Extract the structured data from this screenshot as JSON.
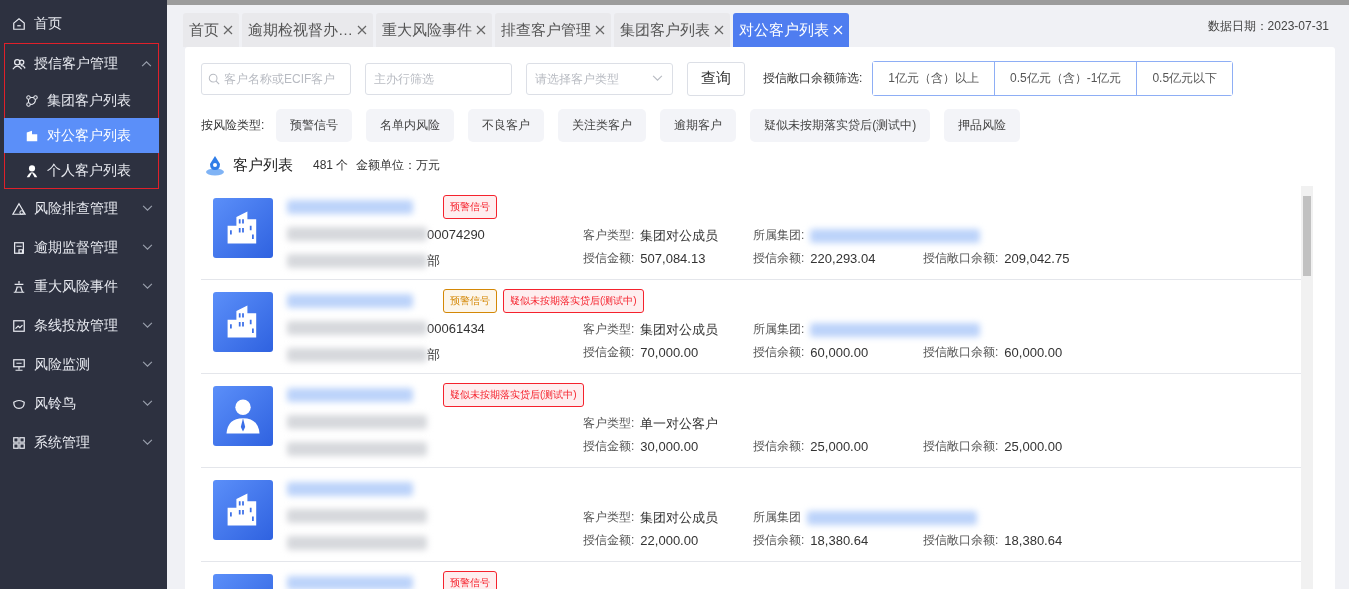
{
  "sidebar": {
    "items": [
      {
        "label": "首页",
        "expanded": false,
        "outlined": false
      },
      {
        "label": "授信客户管理",
        "expanded": true,
        "outlined": true,
        "children": [
          {
            "label": "集团客户列表",
            "selected": false
          },
          {
            "label": "对公客户列表",
            "selected": true
          },
          {
            "label": "个人客户列表",
            "selected": false
          }
        ]
      },
      {
        "label": "风险排查管理",
        "expanded": false,
        "outlined": false
      },
      {
        "label": "逾期监督管理",
        "expanded": false,
        "outlined": false
      },
      {
        "label": "重大风险事件",
        "expanded": false,
        "outlined": false
      },
      {
        "label": "条线投放管理",
        "expanded": false,
        "outlined": false
      },
      {
        "label": "风险监测",
        "expanded": false,
        "outlined": false
      },
      {
        "label": "风铃鸟",
        "expanded": false,
        "outlined": false
      },
      {
        "label": "系统管理",
        "expanded": false,
        "outlined": false
      }
    ]
  },
  "tabs": [
    {
      "label": "首页",
      "selected": false
    },
    {
      "label": "逾期检视督办…",
      "selected": false
    },
    {
      "label": "重大风险事件",
      "selected": false
    },
    {
      "label": "排查客户管理",
      "selected": false
    },
    {
      "label": "集团客户列表",
      "selected": false
    },
    {
      "label": "对公客户列表",
      "selected": true
    }
  ],
  "data_date": "数据日期：2023-07-31",
  "filters": {
    "search": {
      "placeholder": "客户名称或ECIF客户"
    },
    "branch": {
      "placeholder": "主办行筛选"
    },
    "customer_type": {
      "placeholder": "请选择客户类型"
    },
    "query_button": "查询",
    "exposure_label": "授信敞口余额筛选:",
    "exposure_options": [
      {
        "label": "1亿元（含）以上",
        "selected": false
      },
      {
        "label": "0.5亿元（含）-1亿元",
        "selected": false
      },
      {
        "label": "0.5亿元以下",
        "selected": false
      }
    ]
  },
  "risk_filter": {
    "label": "按风险类型:",
    "options": [
      "预警信号",
      "名单内风险",
      "不良客户",
      "关注类客户",
      "逾期客户",
      "疑似未按期落实贷后(测试中)",
      "押品风险"
    ]
  },
  "list": {
    "title": "客户列表",
    "count": "481 个",
    "unit": "金额单位：万元",
    "rows": [
      {
        "kind": "group",
        "badges": [
          {
            "label": "预警信号",
            "color": "#f5222d"
          }
        ],
        "id_tail": "00074290",
        "dept_tail": "部",
        "type_label": "客户类型:",
        "type": "集团对公成员",
        "group_label": "所属集团:",
        "amounts": [
          {
            "label": "授信金额:",
            "value": "507,084.13"
          },
          {
            "label": "授信余额:",
            "value": "220,293.04"
          },
          {
            "label": "授信敞口余额:",
            "value": "209,042.75"
          }
        ]
      },
      {
        "kind": "group",
        "badges": [
          {
            "label": "预警信号",
            "color": "#d48806"
          },
          {
            "label": "疑似未按期落实贷后(测试中)",
            "color": "#f5222d"
          }
        ],
        "id_tail": "00061434",
        "dept_tail": "部",
        "type_label": "客户类型:",
        "type": "集团对公成员",
        "group_label": "所属集团:",
        "amounts": [
          {
            "label": "授信金额:",
            "value": "70,000.00"
          },
          {
            "label": "授信余额:",
            "value": "60,000.00"
          },
          {
            "label": "授信敞口余额:",
            "value": "60,000.00"
          }
        ]
      },
      {
        "kind": "person",
        "badges": [
          {
            "label": "疑似未按期落实贷后(测试中)",
            "color": "#f5222d"
          }
        ],
        "type_label": "客户类型:",
        "type": "单一对公客户",
        "amounts": [
          {
            "label": "授信金额:",
            "value": "30,000.00"
          },
          {
            "label": "授信余额:",
            "value": "25,000.00"
          },
          {
            "label": "授信敞口余额:",
            "value": "25,000.00"
          }
        ]
      },
      {
        "kind": "group",
        "badges": [],
        "type_label": "客户类型:",
        "type": "集团对公成员",
        "group_label": "所属集团",
        "amounts": [
          {
            "label": "授信金额:",
            "value": "22,000.00"
          },
          {
            "label": "授信余额:",
            "value": "18,380.64"
          },
          {
            "label": "授信敞口余额:",
            "value": "18,380.64"
          }
        ]
      },
      {
        "kind": "unknown",
        "badges": [
          {
            "label": "预警信号",
            "color": "#f5222d"
          }
        ]
      }
    ]
  }
}
